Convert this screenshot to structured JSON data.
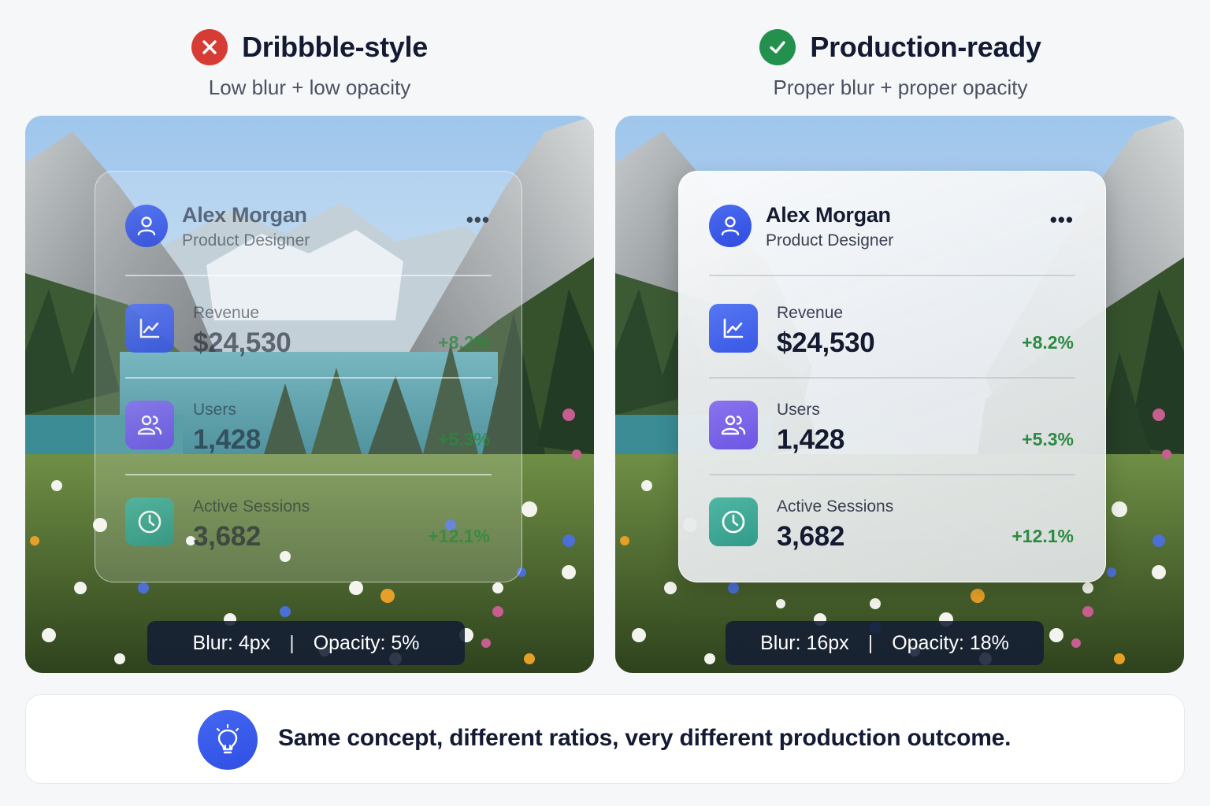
{
  "left": {
    "header": {
      "title": "Dribbble-style",
      "subtitle": "Low blur + low opacity",
      "icon": "x-circle-icon"
    },
    "card": {
      "name": "Alex Morgan",
      "role": "Product Designer",
      "more": "•••",
      "metrics": [
        {
          "label": "Revenue",
          "value": "$24,530",
          "delta": "+8.2%",
          "icon": "line-chart-icon"
        },
        {
          "label": "Users",
          "value": "1,428",
          "delta": "+5.3%",
          "icon": "users-icon"
        },
        {
          "label": "Active Sessions",
          "value": "3,682",
          "delta": "+12.1%",
          "icon": "clock-icon"
        }
      ]
    },
    "caption": {
      "blur": "Blur: 4px",
      "sep": "|",
      "opacity": "Opacity: 5%"
    }
  },
  "right": {
    "header": {
      "title": "Production-ready",
      "subtitle": "Proper blur + proper opacity",
      "icon": "check-circle-icon"
    },
    "card": {
      "name": "Alex Morgan",
      "role": "Product Designer",
      "more": "•••",
      "metrics": [
        {
          "label": "Revenue",
          "value": "$24,530",
          "delta": "+8.2%",
          "icon": "line-chart-icon"
        },
        {
          "label": "Users",
          "value": "1,428",
          "delta": "+5.3%",
          "icon": "users-icon"
        },
        {
          "label": "Active Sessions",
          "value": "3,682",
          "delta": "+12.1%",
          "icon": "clock-icon"
        }
      ]
    },
    "caption": {
      "blur": "Blur: 16px",
      "sep": "|",
      "opacity": "Opacity: 18%"
    }
  },
  "banner": {
    "text": "Same concept, different ratios, very different production outcome.",
    "icon": "lightbulb-icon"
  },
  "colors": {
    "accent": "#3a58e6",
    "positive": "#2c8a43",
    "negative": "#d63b34",
    "success": "#23904e"
  }
}
